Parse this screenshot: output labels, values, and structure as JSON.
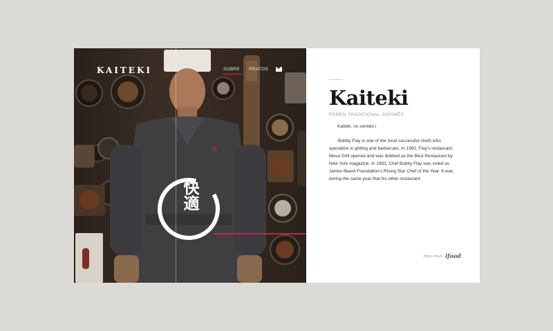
{
  "brand": "KAITEKI",
  "nav": {
    "items": [
      "SOBRE",
      "PRATOS"
    ],
    "active_index": 0
  },
  "hero": {
    "seal_text": "快適",
    "icons": [
      "mail-icon"
    ]
  },
  "content": {
    "title": "Kaiteki",
    "subtitle": "RÁMEN TRADICIONAL JAPONÊS",
    "lead": "Kaiteki, no sentido l",
    "body": "Bobby Flay is one of the most successful chefs who specialize in grilling and barbecues. In 1991, Flay's restaurant, Mesa Grill opened and was dubbed as the Best Restaurant by New York magazine. In 1993, Chef Bobby Flay was voted as James Beard Foundation's Rising Star Chef of the Year. It was during the same year that his other restaurant."
  },
  "order": {
    "label": "PEÇA PELO",
    "service": "ifood"
  },
  "colors": {
    "accent": "#e21b2f",
    "background": "#dcdad6",
    "hero_dark": "#3b2e25"
  }
}
